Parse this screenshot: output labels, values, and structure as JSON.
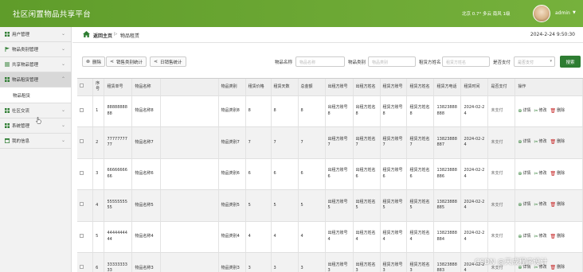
{
  "header": {
    "title": "社区闲置物品共享平台",
    "weather": "北京 0.7° 多云 南风 1级",
    "user": "admin"
  },
  "sidebar": {
    "items": [
      {
        "label": "用户管理"
      },
      {
        "label": "物品类别管理"
      },
      {
        "label": "共享物品管理"
      },
      {
        "label": "物品租赁管理"
      },
      {
        "label": "社区交流"
      },
      {
        "label": "系统管理"
      },
      {
        "label": "我的信息"
      }
    ],
    "sub_item": "物品租赁"
  },
  "breadcrumb": {
    "home": "返回主页",
    "separator": "▷",
    "current": "物品租赁"
  },
  "datetime": "2024-2-24 9:50:30",
  "toolbar": {
    "delete_label": "删除",
    "stats1_label": "销售类别统计",
    "stats2_label": "日销售统计",
    "name_label": "物品名称",
    "name_placeholder": "物品名称",
    "category_label": "物品类别",
    "category_placeholder": "物品类别",
    "renter_label": "租赁方姓名",
    "renter_placeholder": "租赁方姓名",
    "paid_label": "是否支付",
    "paid_placeholder": "是否支付",
    "search_label": "搜索"
  },
  "table": {
    "headers": [
      "序号",
      "租赁单号",
      "物品名称",
      "",
      "物品类别",
      "租赁价格",
      "租赁天数",
      "总金额",
      "出租方账号",
      "出租方姓名",
      "租赁方账号",
      "租赁方姓名",
      "租赁方电话",
      "租赁时间",
      "是否支付",
      "操作"
    ],
    "rows": [
      {
        "no": "1",
        "order": "8888888888",
        "name": "物品名称8",
        "category": "物品类别8",
        "price": "8",
        "days": "8",
        "total": "8",
        "owner_acc": "出租方账号8",
        "owner_name": "出租方姓名8",
        "renter_acc": "租赁方账号8",
        "renter_name": "租赁方姓名8",
        "phone": "13823888888",
        "date": "2024-02-24",
        "paid": "未支付"
      },
      {
        "no": "2",
        "order": "7777777777",
        "name": "物品名称7",
        "category": "物品类别7",
        "price": "7",
        "days": "7",
        "total": "7",
        "owner_acc": "出租方账号7",
        "owner_name": "出租方姓名7",
        "renter_acc": "租赁方账号7",
        "renter_name": "租赁方姓名7",
        "phone": "13823888887",
        "date": "2024-02-24",
        "paid": "未支付"
      },
      {
        "no": "3",
        "order": "6666666666",
        "name": "物品名称6",
        "category": "物品类别6",
        "price": "6",
        "days": "6",
        "total": "6",
        "owner_acc": "出租方账号6",
        "owner_name": "出租方姓名6",
        "renter_acc": "租赁方账号6",
        "renter_name": "租赁方姓名6",
        "phone": "13823888886",
        "date": "2024-02-24",
        "paid": "未支付"
      },
      {
        "no": "4",
        "order": "5555555555",
        "name": "物品名称5",
        "category": "物品类别5",
        "price": "5",
        "days": "5",
        "total": "5",
        "owner_acc": "出租方账号5",
        "owner_name": "出租方姓名5",
        "renter_acc": "租赁方账号5",
        "renter_name": "租赁方姓名5",
        "phone": "13823888885",
        "date": "2024-02-24",
        "paid": "未支付"
      },
      {
        "no": "5",
        "order": "4444444444",
        "name": "物品名称4",
        "category": "物品类别4",
        "price": "4",
        "days": "4",
        "total": "4",
        "owner_acc": "出租方账号4",
        "owner_name": "出租方姓名4",
        "renter_acc": "租赁方账号4",
        "renter_name": "租赁方姓名4",
        "phone": "13823888884",
        "date": "2024-02-24",
        "paid": "未支付"
      },
      {
        "no": "6",
        "order": "3333333333",
        "name": "物品名称3",
        "category": "物品类别3",
        "price": "3",
        "days": "3",
        "total": "3",
        "owner_acc": "出租方账号3",
        "owner_name": "出租方姓名3",
        "renter_acc": "租赁方账号3",
        "renter_name": "租赁方姓名3",
        "phone": "13823888883",
        "date": "2024-02-24",
        "paid": "未支付"
      }
    ],
    "actions": {
      "detail": "详情",
      "edit": "修改",
      "delete": "删除"
    }
  },
  "watermark": "CSDN @天成程序设计",
  "colors": {
    "header_green": "#6aa632",
    "search_button": "#2e7d32",
    "delete_icon": "#c62828"
  }
}
